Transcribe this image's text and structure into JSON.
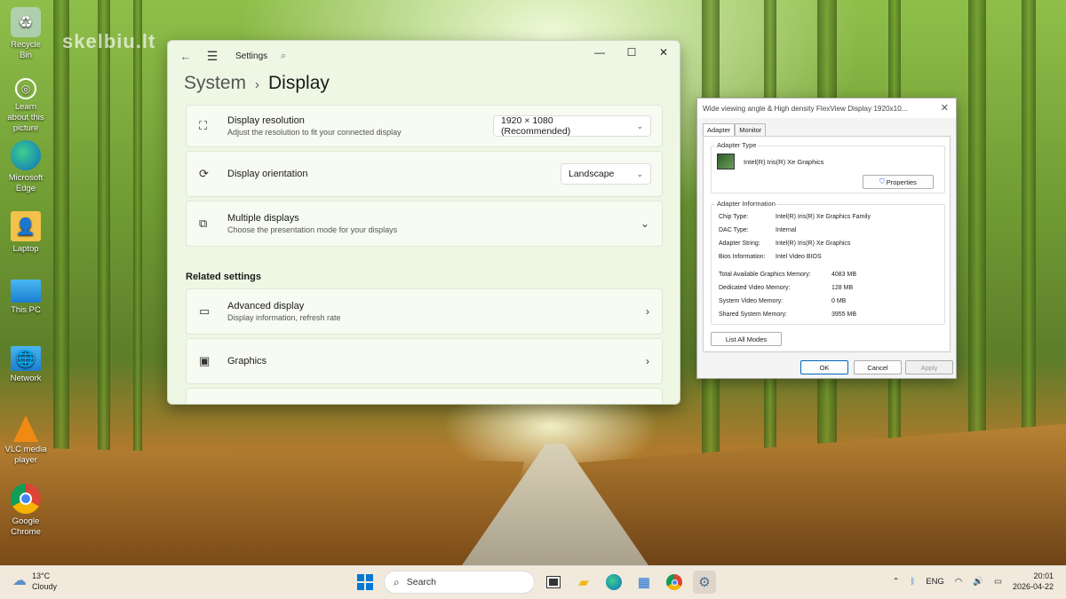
{
  "desktop": {
    "icons": [
      {
        "label": "Recycle Bin",
        "icon": "recycle-bin-icon"
      },
      {
        "label": "Learn about this picture",
        "icon": "camera-icon"
      },
      {
        "label": "Microsoft Edge",
        "icon": "edge-icon"
      },
      {
        "label": "Laptop",
        "icon": "folder-user-icon"
      },
      {
        "label": "This PC",
        "icon": "monitor-icon"
      },
      {
        "label": "Network",
        "icon": "network-icon"
      },
      {
        "label": "VLC media player",
        "icon": "vlc-icon"
      },
      {
        "label": "Google Chrome",
        "icon": "chrome-icon"
      }
    ],
    "watermark": "skelbiu.lt"
  },
  "settings": {
    "app_title": "Settings",
    "breadcrumb": {
      "parent": "System",
      "separator": "›",
      "current": "Display"
    },
    "cards": {
      "resolution": {
        "title": "Display resolution",
        "subtitle": "Adjust the resolution to fit your connected display",
        "value": "1920 × 1080 (Recommended)"
      },
      "orientation": {
        "title": "Display orientation",
        "value": "Landscape"
      },
      "multiple": {
        "title": "Multiple displays",
        "subtitle": "Choose the presentation mode for your displays"
      }
    },
    "related_title": "Related settings",
    "related": {
      "advanced": {
        "title": "Advanced display",
        "subtitle": "Display information, refresh rate"
      },
      "graphics": {
        "title": "Graphics"
      }
    }
  },
  "dialog": {
    "title": "Wide viewing angle & High density FlexView Display 1920x10...",
    "tabs": [
      "Adapter",
      "Monitor"
    ],
    "adapter_type_label": "Adapter Type",
    "adapter_name": "Intel(R) Iris(R) Xe Graphics",
    "properties_button": "Properties",
    "adapter_info_label": "Adapter Information",
    "info": [
      {
        "key": "Chip Type:",
        "value": "Intel(R) Iris(R) Xe Graphics Family"
      },
      {
        "key": "DAC Type:",
        "value": "Internal"
      },
      {
        "key": "Adapter String:",
        "value": "Intel(R) Iris(R) Xe Graphics"
      },
      {
        "key": "Bios Information:",
        "value": "Intel Video BIOS"
      }
    ],
    "memory": [
      {
        "key": "Total Available Graphics Memory:",
        "value": "4083 MB"
      },
      {
        "key": "Dedicated Video Memory:",
        "value": "128 MB"
      },
      {
        "key": "System Video Memory:",
        "value": "0 MB"
      },
      {
        "key": "Shared System Memory:",
        "value": "3955 MB"
      }
    ],
    "list_modes_button": "List All Modes",
    "ok": "OK",
    "cancel": "Cancel",
    "apply": "Apply"
  },
  "taskbar": {
    "weather_temp": "13°C",
    "weather_desc": "Cloudy",
    "search_placeholder": "Search",
    "language": "ENG",
    "time": "20:01",
    "date": "2026-04-22"
  }
}
